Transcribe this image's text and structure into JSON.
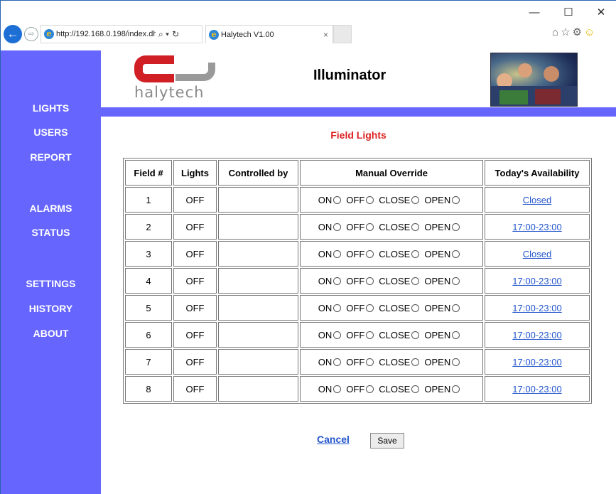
{
  "window": {
    "minimize": "—",
    "maximize": "☐",
    "close": "✕"
  },
  "browser": {
    "address": "http://192.168.0.198/index.dh",
    "address_search_icon": "⌕ ▾",
    "address_refresh_icon": "↻",
    "tab_title": "Halytech V1.00",
    "tab_close": "×",
    "back_icon": "←",
    "forward_icon": "⇨",
    "toolbar_icons": [
      "home-icon",
      "favorites-star-icon",
      "settings-gear-icon",
      "feedback-smiley-icon"
    ]
  },
  "header": {
    "logo_text": "halytech",
    "app_title": "Illuminator"
  },
  "sidebar": {
    "items": [
      {
        "label": "LIGHTS"
      },
      {
        "label": "USERS"
      },
      {
        "label": "REPORT"
      },
      {
        "label": "ALARMS"
      },
      {
        "label": "STATUS"
      },
      {
        "label": "SETTINGS"
      },
      {
        "label": "HISTORY"
      },
      {
        "label": "ABOUT"
      }
    ]
  },
  "main": {
    "section_title": "Field Lights",
    "table": {
      "headers": [
        "Field #",
        "Lights",
        "Controlled by",
        "Manual Override",
        "Today's Availability"
      ],
      "override_options": [
        "ON",
        "OFF",
        "CLOSE",
        "OPEN"
      ],
      "rows": [
        {
          "field": "1",
          "lights": "OFF",
          "controlled_by": "",
          "availability": "Closed"
        },
        {
          "field": "2",
          "lights": "OFF",
          "controlled_by": "",
          "availability": "17:00-23:00"
        },
        {
          "field": "3",
          "lights": "OFF",
          "controlled_by": "",
          "availability": "Closed"
        },
        {
          "field": "4",
          "lights": "OFF",
          "controlled_by": "",
          "availability": "17:00-23:00"
        },
        {
          "field": "5",
          "lights": "OFF",
          "controlled_by": "",
          "availability": "17:00-23:00"
        },
        {
          "field": "6",
          "lights": "OFF",
          "controlled_by": "",
          "availability": "17:00-23:00"
        },
        {
          "field": "7",
          "lights": "OFF",
          "controlled_by": "",
          "availability": "17:00-23:00"
        },
        {
          "field": "8",
          "lights": "OFF",
          "controlled_by": "",
          "availability": "17:00-23:00"
        }
      ]
    },
    "cancel_label": "Cancel",
    "save_label": "Save"
  },
  "colors": {
    "sidebar": "#6666ff",
    "section_title": "#dd2222",
    "link": "#2255cc",
    "logo_red": "#d11f26"
  }
}
